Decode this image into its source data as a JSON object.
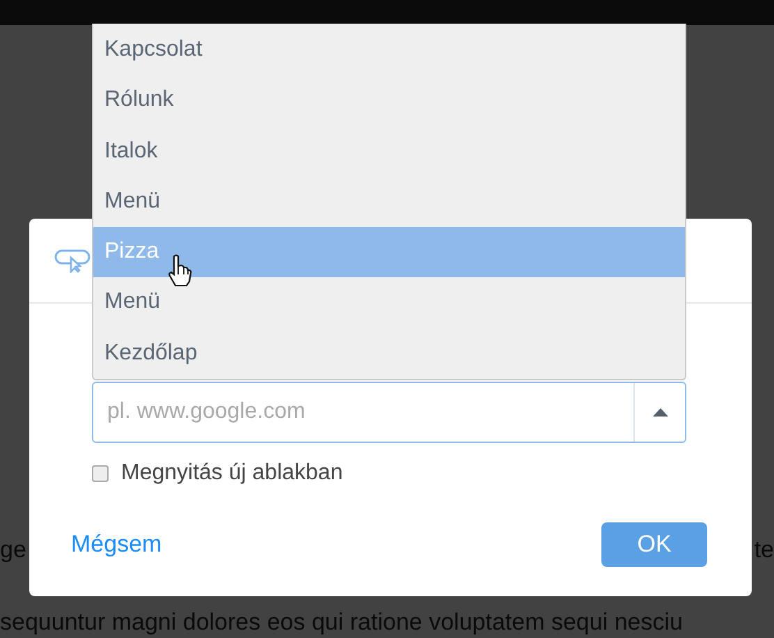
{
  "background_lines": [
    {
      "left": "ge",
      "right": "te"
    },
    {
      "left": "sequuntur magni dolores eos qui ratione voluptatem sequi nesciu"
    }
  ],
  "dialog": {
    "url_field": {
      "placeholder": "pl. www.google.com"
    },
    "new_window": {
      "label": "Megnyitás új ablakban",
      "checked": false
    },
    "cancel": "Mégsem",
    "ok": "OK"
  },
  "dropdown": {
    "items": [
      {
        "label": "Kapcsolat",
        "selected": false
      },
      {
        "label": "Rólunk",
        "selected": false
      },
      {
        "label": "Italok",
        "selected": false
      },
      {
        "label": "Menü",
        "selected": false
      },
      {
        "label": "Pizza",
        "selected": true
      },
      {
        "label": "Menü",
        "selected": false
      },
      {
        "label": "Kezdőlap",
        "selected": false
      }
    ]
  }
}
